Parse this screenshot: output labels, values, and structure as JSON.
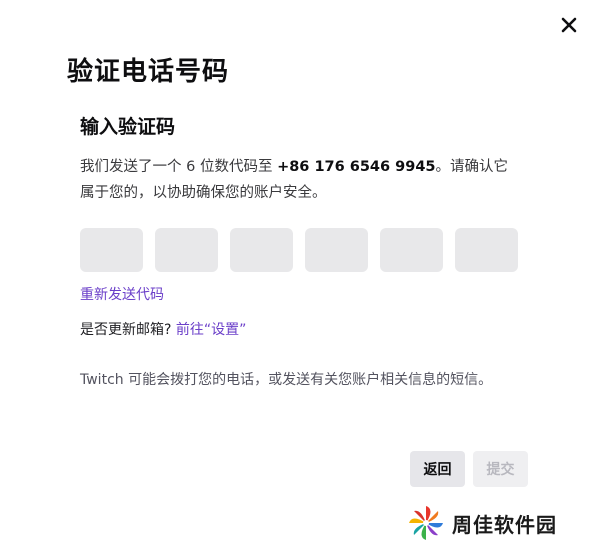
{
  "dialog": {
    "title": "验证电话号码",
    "subtitle": "输入验证码",
    "description_prefix": "我们发送了一个 6 位数代码至 ",
    "phone_number": "+86 176 6546 9945",
    "description_suffix": "。请确认它属于您的，以协助确保您的账户安全。",
    "code_inputs": [
      "",
      "",
      "",
      "",
      "",
      ""
    ],
    "resend_label": "重新发送代码",
    "email_question": "是否更新邮箱? ",
    "email_link": "前往“设置”",
    "notice": "Twitch 可能会拨打您的电话，或发送有关您账户相关信息的短信。",
    "back_label": "返回",
    "submit_label": "提交",
    "close_icon": "close-icon"
  },
  "watermark": {
    "text": "周佳软件园",
    "logo_icon": "pinwheel-logo-icon"
  },
  "colors": {
    "accent": "#6b3fc9",
    "input_bg": "#e8e8ea",
    "button_secondary": "#e6e6ea",
    "button_disabled": "#efeff1"
  }
}
